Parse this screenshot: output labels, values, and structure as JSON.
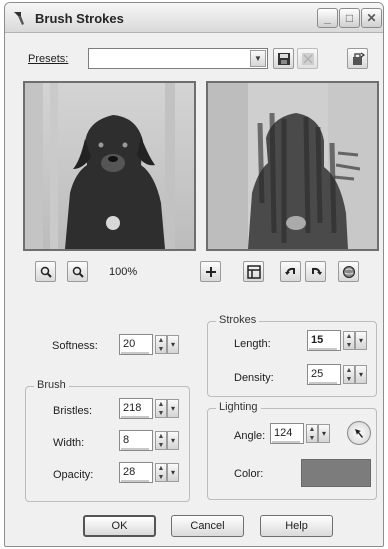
{
  "window": {
    "title": "Brush Strokes",
    "minimize_glyph": "_",
    "maximize_glyph": "□",
    "close_glyph": "✕"
  },
  "presets": {
    "label": "Presets:",
    "value": ""
  },
  "zoom": {
    "value": "100%"
  },
  "softness": {
    "label": "Softness:",
    "value": "20"
  },
  "brush": {
    "group_title": "Brush",
    "bristles": {
      "label": "Bristles:",
      "value": "218"
    },
    "width": {
      "label": "Width:",
      "value": "8"
    },
    "opacity": {
      "label": "Opacity:",
      "value": "28"
    }
  },
  "strokes": {
    "group_title": "Strokes",
    "length": {
      "label": "Length:",
      "value": "15"
    },
    "density": {
      "label": "Density:",
      "value": "25"
    }
  },
  "lighting": {
    "group_title": "Lighting",
    "angle": {
      "label": "Angle:",
      "value": "124"
    },
    "color": {
      "label": "Color:",
      "swatch": "#7c7c7c"
    }
  },
  "buttons": {
    "ok": "OK",
    "cancel": "Cancel",
    "help": "Help"
  },
  "colors": {
    "dialog_bg": "#f0f0f0",
    "border": "#8d8d8d"
  }
}
